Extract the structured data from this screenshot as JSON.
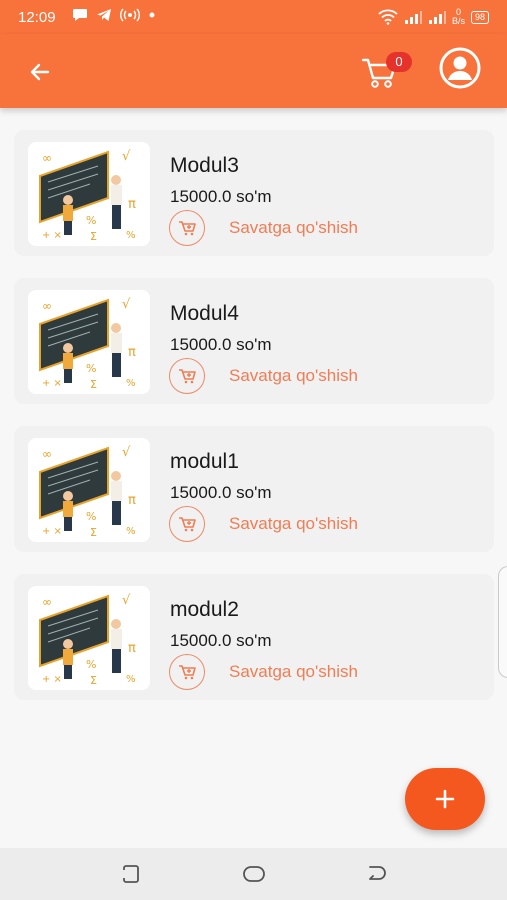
{
  "status_bar": {
    "time": "12:09",
    "net_speed_value": "0",
    "net_speed_unit": "B/s",
    "battery": "98"
  },
  "app_bar": {
    "back_icon": "arrow-left-icon",
    "cart_icon": "cart-icon",
    "cart_count": "0",
    "profile_icon": "account-circle-icon"
  },
  "products": [
    {
      "title": "Modul3",
      "price": "15000.0 so'm",
      "add_label": "Savatga qo'shish"
    },
    {
      "title": "Modul4",
      "price": "15000.0 so'm",
      "add_label": "Savatga qo'shish"
    },
    {
      "title": "modul1",
      "price": "15000.0 so'm",
      "add_label": "Savatga qo'shish"
    },
    {
      "title": "modul2",
      "price": "15000.0 so'm",
      "add_label": "Savatga qo'shish"
    }
  ],
  "fab": {
    "icon": "plus-icon"
  },
  "nav_bar": {
    "recents_icon": "recents-icon",
    "home_icon": "home-icon",
    "back_icon": "back-icon"
  },
  "colors": {
    "primary": "#f8723c",
    "fab": "#f4581f",
    "badge": "#e5322b",
    "accent_text": "#ef7d55"
  }
}
